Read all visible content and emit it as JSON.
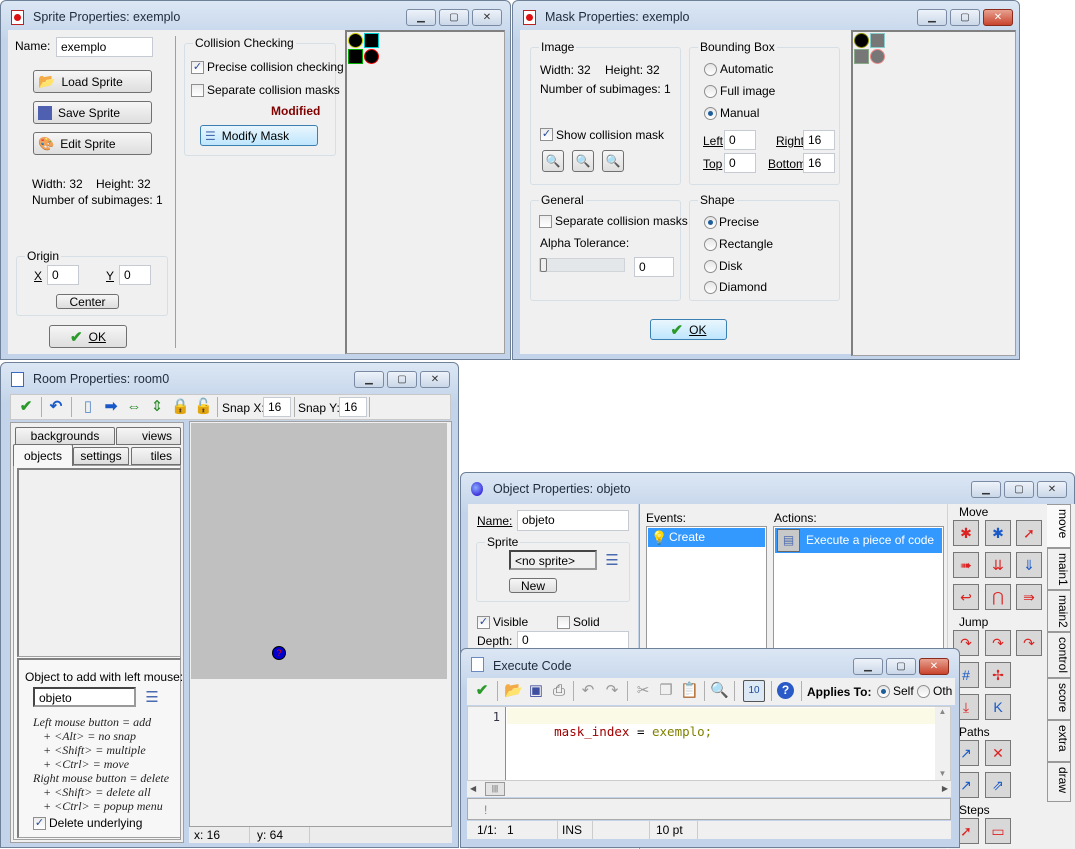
{
  "sprite_window": {
    "title": "Sprite Properties: exemplo",
    "name_label": "Name:",
    "name_value": "exemplo",
    "load_label": "Load Sprite",
    "save_label": "Save Sprite",
    "edit_label": "Edit Sprite",
    "width_text": "Width: 32",
    "height_text": "Height: 32",
    "subimages_text": "Number of subimages: 1",
    "origin_label": "Origin",
    "x_label": "X",
    "x_value": "0",
    "y_label": "Y",
    "y_value": "0",
    "center_label": "Center",
    "ok_label": "OK",
    "collision_label": "Collision Checking",
    "precise_label": "Precise collision checking",
    "precise_checked": true,
    "separate_label": "Separate collision masks",
    "separate_checked": false,
    "modified_text": "Modified",
    "modify_mask_label": "Modify Mask"
  },
  "mask_window": {
    "title": "Mask Properties: exemplo",
    "image_label": "Image",
    "width_text": "Width: 32",
    "height_text": "Height: 32",
    "subimages_text": "Number of subimages: 1",
    "show_mask_label": "Show collision mask",
    "show_mask_checked": true,
    "bbox_label": "Bounding Box",
    "bbox_options": [
      "Automatic",
      "Full image",
      "Manual"
    ],
    "bbox_selected": "Manual",
    "left_label": "Left",
    "left_value": "0",
    "right_label": "Right",
    "right_value": "16",
    "top_label": "Top",
    "top_value": "0",
    "bottom_label": "Bottom",
    "bottom_value": "16",
    "general_label": "General",
    "separate_label": "Separate collision masks",
    "alpha_label": "Alpha Tolerance:",
    "alpha_value": "0",
    "shape_label": "Shape",
    "shape_options": [
      "Precise",
      "Rectangle",
      "Disk",
      "Diamond"
    ],
    "shape_selected": "Precise",
    "ok_label": "OK"
  },
  "room_window": {
    "title": "Room Properties: room0",
    "snap_x_label": "Snap X:",
    "snap_x_value": "16",
    "snap_y_label": "Snap Y:",
    "snap_y_value": "16",
    "tabs": [
      "backgrounds",
      "views",
      "objects",
      "settings",
      "tiles"
    ],
    "active_tab": "objects",
    "object_to_add_label": "Object to add with left mouse:",
    "object_value": "objeto",
    "help_lines": [
      "Left mouse button = add",
      "+ <Alt> = no snap",
      "+ <Shift> = multiple",
      "+ <Ctrl> = move",
      "Right mouse button = delete",
      "+ <Shift> = delete all",
      "+ <Ctrl> = popup menu"
    ],
    "delete_underlying_label": "Delete underlying",
    "delete_underlying_checked": true,
    "status_x": "x: 16",
    "status_y": "y: 64"
  },
  "object_window": {
    "title": "Object Properties: objeto",
    "name_label": "Name:",
    "name_value": "objeto",
    "sprite_label": "Sprite",
    "sprite_value": "<no sprite>",
    "new_label": "New",
    "visible_label": "Visible",
    "visible_checked": true,
    "solid_label": "Solid",
    "solid_checked": false,
    "depth_label": "Depth:",
    "depth_value": "0",
    "events_label": "Events:",
    "events": [
      "Create"
    ],
    "actions_label": "Actions:",
    "actions": [
      "Execute a piece of code"
    ],
    "groups": [
      "Move",
      "Jump",
      "Paths",
      "Steps"
    ],
    "side_tabs": [
      "move",
      "main1",
      "main2",
      "control",
      "score",
      "extra",
      "draw"
    ],
    "active_side_tab": "move"
  },
  "code_window": {
    "title": "Execute Code",
    "applies_to_label": "Applies To:",
    "self_label": "Self",
    "other_label": "Oth",
    "applies_selected": "Self",
    "line_number": "1",
    "code_var": "mask_index",
    "code_op": " = ",
    "code_val": "exemplo;",
    "message": "!",
    "status_pos": "1/1:",
    "status_col": "1",
    "status_mode": "INS",
    "status_font": "10 pt"
  },
  "colors": {
    "accent_selection": "#3399ff",
    "modified_text": "#800000",
    "room_canvas": "#c0c0c0",
    "code_line_highlight": "#fafae6"
  }
}
